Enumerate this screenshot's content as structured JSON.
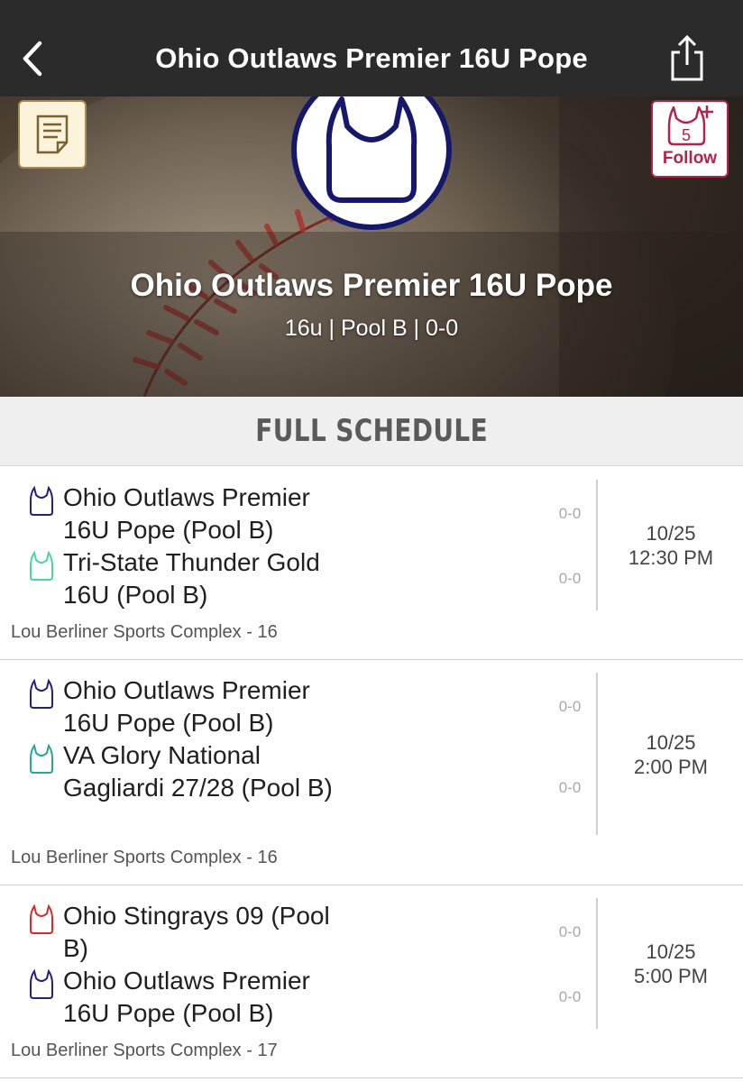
{
  "header": {
    "title": "Ohio Outlaws Premier 16U Pope"
  },
  "hero": {
    "team_name": "Ohio Outlaws Premier 16U Pope",
    "subtitle": "16u | Pool B | 0-0",
    "follow_label": "Follow",
    "follow_count": "5"
  },
  "schedule": {
    "title": "FULL SCHEDULE",
    "games": [
      {
        "team1": "Ohio Outlaws Premier 16U Pope (Pool B)",
        "team1_color": "#22227a",
        "score1": "0-0",
        "team2": "Tri-State Thunder Gold 16U (Pool B)",
        "team2_color": "#4fd49a",
        "score2": "0-0",
        "date": "10/25",
        "time": "12:30 PM",
        "venue": "Lou Berliner Sports Complex - 16"
      },
      {
        "team1": "Ohio Outlaws Premier 16U Pope (Pool B)",
        "team1_color": "#22227a",
        "score1": "0-0",
        "team2": "VA Glory National Gagliardi 27/28 (Pool B)",
        "team2_color": "#2aa39a",
        "score2": "0-0",
        "date": "10/25",
        "time": "2:00 PM",
        "venue": "Lou Berliner Sports Complex - 16"
      },
      {
        "team1": "Ohio Stingrays 09 (Pool B)",
        "team1_color": "#d62a2a",
        "score1": "0-0",
        "team2": "Ohio Outlaws Premier 16U Pope (Pool B)",
        "team2_color": "#22227a",
        "score2": "0-0",
        "date": "10/25",
        "time": "5:00 PM",
        "venue": "Lou Berliner Sports Complex - 17"
      }
    ]
  },
  "icons": {
    "back": "chevron-left-icon",
    "share": "share-icon",
    "notes": "notes-icon",
    "team_logo": "jersey-icon",
    "follow": "jersey-plus-icon"
  },
  "colors": {
    "navbar": "#2b2b2b",
    "logo_border": "#16186b",
    "follow_accent": "#b3234a"
  }
}
